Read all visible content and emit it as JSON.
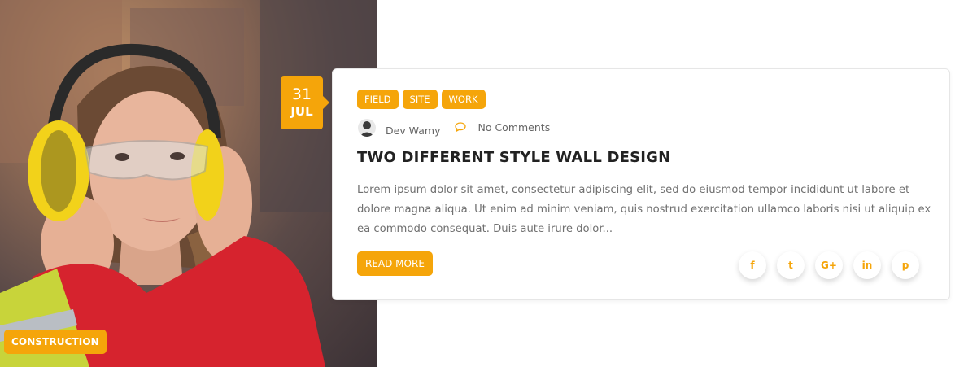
{
  "post": {
    "category": "CONSTRUCTION",
    "date": {
      "day": "31",
      "month": "JUL"
    },
    "tags": [
      "FIELD",
      "SITE",
      "WORK"
    ],
    "author": "Dev Wamy",
    "comments": "No Comments",
    "title": "TWO DIFFERENT STYLE WALL DESIGN",
    "excerpt": "Lorem ipsum dolor sit amet, consectetur adipiscing elit, sed do eiusmod tempor incididunt ut labore et dolore magna aliqua. Ut enim ad minim veniam, quis nostrud exercitation ullamco laboris nisi ut aliquip ex ea commodo consequat. Duis aute irure dolor...",
    "read_more_label": "READ MORE"
  },
  "social": [
    {
      "icon": "facebook-icon",
      "glyph": "f"
    },
    {
      "icon": "twitter-icon",
      "glyph": "t"
    },
    {
      "icon": "google-plus-icon",
      "glyph": "G+"
    },
    {
      "icon": "linkedin-icon",
      "glyph": "in"
    },
    {
      "icon": "pinterest-icon",
      "glyph": "p"
    }
  ],
  "colors": {
    "accent": "#f5a50a",
    "title_text": "#222222",
    "body_text": "#707070"
  }
}
